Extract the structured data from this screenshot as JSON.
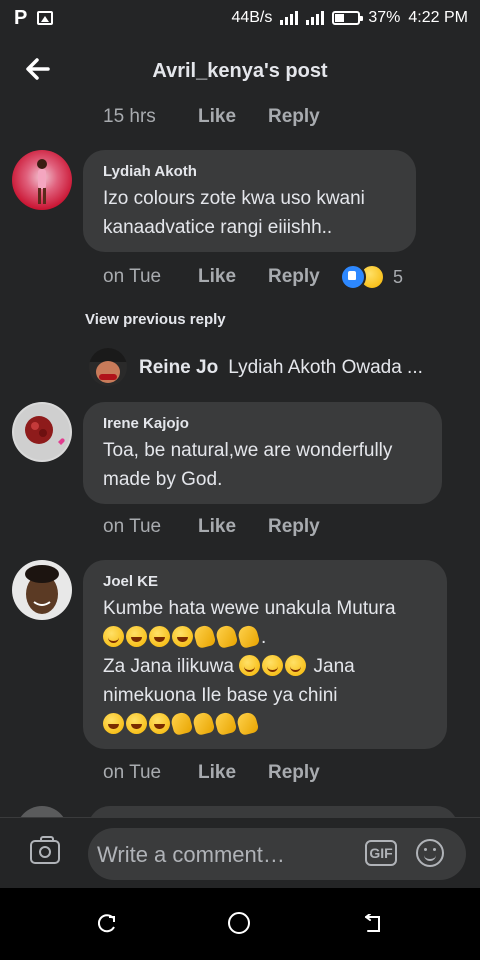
{
  "status_bar": {
    "app_logo": "P",
    "network_speed": "44B/s",
    "battery_percent": "37%",
    "time": "4:22 PM"
  },
  "header": {
    "title": "Avril_kenya's post",
    "back_icon": "back-arrow-icon"
  },
  "top_meta": {
    "time": "15 hrs",
    "like": "Like",
    "reply": "Reply"
  },
  "comments": [
    {
      "author": "Lydiah Akoth",
      "lines": [
        "Izo colours zote kwa uso kwani",
        "kanaadvatice rangi  eiiishh.."
      ],
      "time": "on Tue",
      "like": "Like",
      "reply": "Reply",
      "reaction_count": "5"
    },
    {
      "author": "Irene Kajojo",
      "lines": [
        "Toa, be natural,we are wonderfully",
        "made by God."
      ],
      "time": "on Tue",
      "like": "Like",
      "reply": "Reply"
    },
    {
      "author": "Joel KE",
      "lines": [
        "Kumbe hata wewe unakula Mutura",
        ".",
        "Za Jana ilikuwa",
        "Jana",
        "nimekuona Ile base ya chini"
      ],
      "time": "on Tue",
      "like": "Like",
      "reply": "Reply"
    }
  ],
  "view_previous_reply": "View previous reply",
  "nested_reply": {
    "author": "Reine Jo",
    "preview": "Lydiah Akoth Owada ..."
  },
  "composer": {
    "placeholder": "Write a comment…",
    "gif_label": "GIF"
  },
  "colors": {
    "background": "#242526",
    "bubble": "#3a3b3c",
    "muted_text": "#a8abaf",
    "like_blue": "#2d88ff"
  }
}
